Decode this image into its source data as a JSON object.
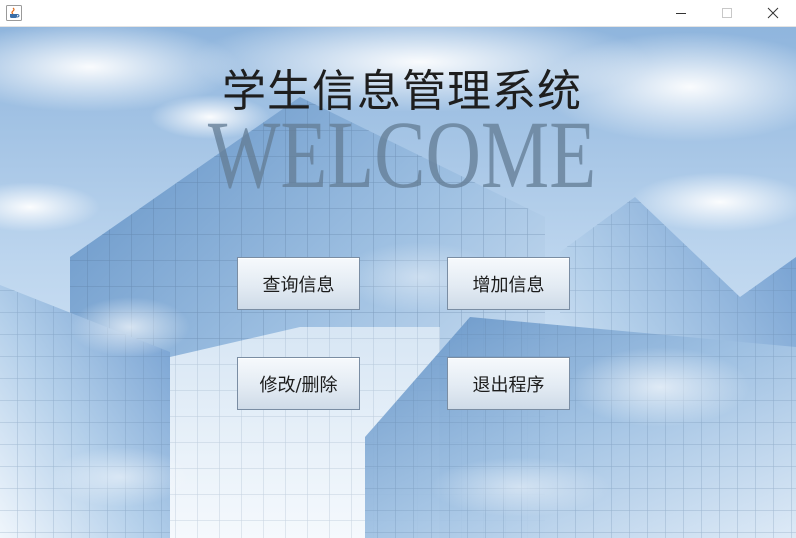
{
  "window": {
    "title": "",
    "controls": {
      "minimize_icon": "minimize-icon",
      "maximize_icon": "maximize-icon",
      "close_icon": "close-icon"
    }
  },
  "main": {
    "title": "学生信息管理系统",
    "welcome": "WELCOME",
    "buttons": {
      "query": "查询信息",
      "add": "增加信息",
      "modify_delete": "修改/删除",
      "exit": "退出程序"
    }
  },
  "colors": {
    "sky": "#a9c8e6",
    "glass": "#6f98c8",
    "button_border": "#7a8da3"
  }
}
